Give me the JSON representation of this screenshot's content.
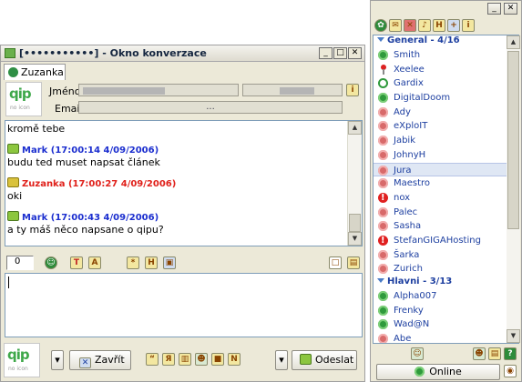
{
  "chat_window": {
    "title_uin": "[•••••••••••]",
    "title": "- Okno konverzace",
    "tab_label": "Zuzanka",
    "logo_text": "qip",
    "logo_sub": "no icon",
    "name_label": "Jméno:",
    "email_label": "Email:",
    "email_value": "...",
    "messages": [
      {
        "text": "kromě tebe",
        "header": ""
      },
      {
        "header": "Mark (17:00:14 4/09/2006)",
        "sender": "Mark",
        "text": "budu ted muset napsat článek"
      },
      {
        "header": "Zuzanka (17:00:27 4/09/2006)",
        "sender": "Zuzanka",
        "text": "oki"
      },
      {
        "header": "Mark (17:00:43 4/09/2006)",
        "sender": "Mark",
        "text": "a ty máš něco napsane o qipu?"
      }
    ],
    "char_count": "0",
    "close_button": "Zavřít",
    "send_button": "Odeslat"
  },
  "roster": {
    "groups": [
      {
        "name": "General - 4/16",
        "contacts": [
          {
            "name": "Smith",
            "status": "on"
          },
          {
            "name": "Xeelee",
            "status": "pin"
          },
          {
            "name": "Gardix",
            "status": "ring"
          },
          {
            "name": "DigitalDoom",
            "status": "on"
          },
          {
            "name": "Ady",
            "status": "off"
          },
          {
            "name": "eXploIT",
            "status": "off"
          },
          {
            "name": "Jabik",
            "status": "off"
          },
          {
            "name": "JohnyH",
            "status": "off"
          },
          {
            "name": "Jura",
            "status": "off",
            "selected": true
          },
          {
            "name": "Maestro",
            "status": "off"
          },
          {
            "name": "nox",
            "status": "na"
          },
          {
            "name": "Palec",
            "status": "off"
          },
          {
            "name": "Sasha",
            "status": "off"
          },
          {
            "name": "StefanGIGAHosting",
            "status": "na"
          },
          {
            "name": "Šarka",
            "status": "off"
          },
          {
            "name": "Zurich",
            "status": "off"
          }
        ]
      },
      {
        "name": "Hlavni - 3/13",
        "contacts": [
          {
            "name": "Alpha007",
            "status": "on"
          },
          {
            "name": "Frenky",
            "status": "on"
          },
          {
            "name": "Wad@N",
            "status": "on"
          },
          {
            "name": "Abe",
            "status": "off"
          }
        ]
      }
    ],
    "status_label": "Online"
  }
}
